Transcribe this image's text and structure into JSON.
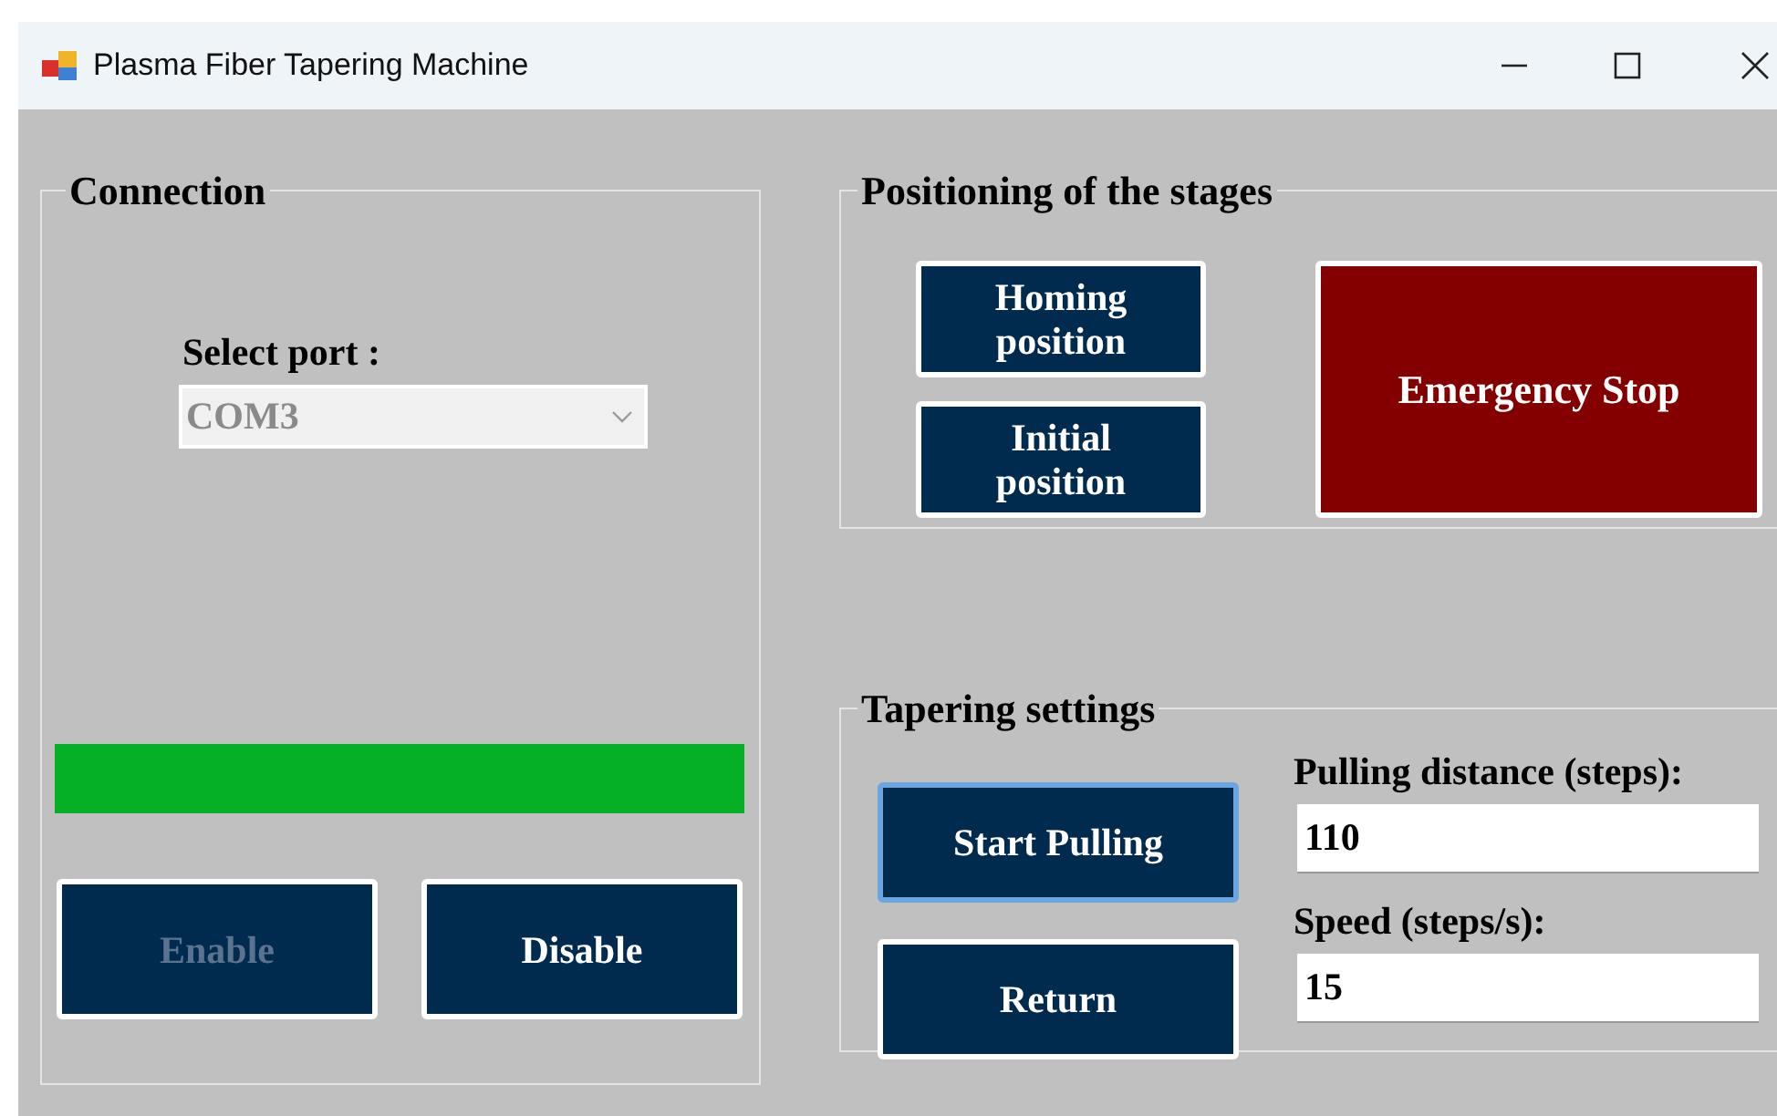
{
  "window": {
    "title": "Plasma Fiber Tapering Machine"
  },
  "connection": {
    "title": "Connection",
    "port_label": "Select port :",
    "port": {
      "value": "COM3",
      "disabled": true
    },
    "status_bar": {
      "level": 1
    },
    "buttons": [
      {
        "label": "Enable",
        "disabled": true
      },
      {
        "label": "Disable",
        "disabled": false
      }
    ]
  },
  "positioning": {
    "title": "Positioning of the stages",
    "buttons": [
      {
        "label": "Homing position"
      },
      {
        "label": "Initial position"
      }
    ],
    "emergency": {
      "label": "Emergency Stop"
    }
  },
  "tapering": {
    "title": "Tapering settings",
    "buttons": [
      {
        "label": "Start Pulling",
        "focused": true
      },
      {
        "label": "Return",
        "focused": false
      }
    ],
    "fields": [
      {
        "label": "Pulling distance (steps):",
        "value": "110"
      },
      {
        "label": "Speed (steps/s):",
        "value": "15"
      }
    ]
  }
}
